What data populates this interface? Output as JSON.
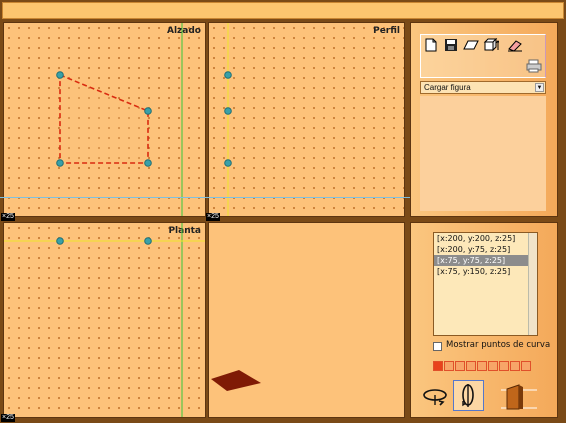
{
  "views": {
    "alzado": "Alzado",
    "perfil": "Perfil",
    "planta": "Planta"
  },
  "zoom_labels": {
    "alzado": "×25",
    "perfil": "×25",
    "planta": "×25"
  },
  "toolbar": {
    "dropdown_value": "Cargar figura"
  },
  "points": [
    "[x:200, y:200, z:25]",
    "[x:200, y:75, z:25]",
    "[x:75, y:75, z:25]",
    "[x:75, y:150, z:25]"
  ],
  "selected_point_index": 2,
  "show_curve_points": {
    "label": "Mostrar puntos de curva",
    "checked": false
  },
  "colors": {
    "background": "#7a4a17",
    "panel": "#fdc27a",
    "shape_edge": "#d92b10",
    "shape_fill": "#7f1a05",
    "vertex": "#3aa0a8",
    "axis_green": "#37c83c",
    "axis_yellow": "#f0e62a",
    "axis_blue": "#7fc0e0",
    "swatch_selected": "#e8431c"
  },
  "icons": [
    "new-file-icon",
    "save-icon",
    "parallelogram-icon",
    "extrude-icon",
    "eraser-icon",
    "print-icon",
    "rotate-icon",
    "rotate-axis-icon",
    "door-icon"
  ]
}
